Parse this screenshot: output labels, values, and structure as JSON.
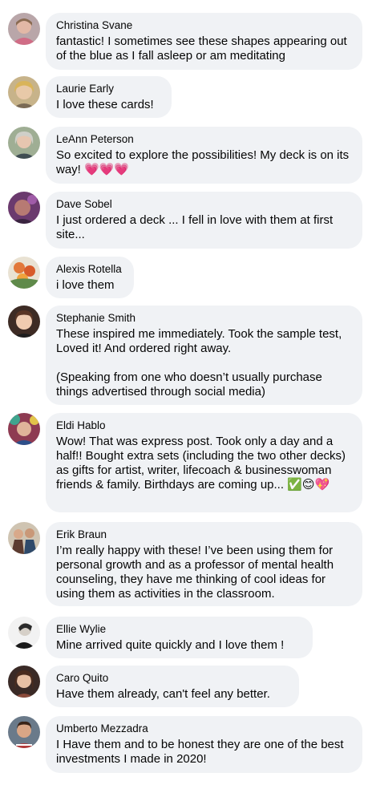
{
  "comments": [
    {
      "author": "Christina Svane",
      "text": "fantastic! I sometimes see these shapes appearing out of the blue as I fall asleep or am meditating",
      "avatar_icon": "profile-photo-icon"
    },
    {
      "author": "Laurie Early",
      "text": "I love these cards!",
      "avatar_icon": "profile-photo-icon"
    },
    {
      "author": "LeAnn Peterson",
      "text": "So excited to explore the possibilities! My deck is on its way! 💗💗💗",
      "avatar_icon": "profile-photo-icon"
    },
    {
      "author": "Dave Sobel",
      "text": "I just ordered a deck ... I fell in love with them at first site...",
      "avatar_icon": "profile-photo-icon"
    },
    {
      "author": "Alexis Rotella",
      "text": "i love them",
      "avatar_icon": "profile-photo-icon"
    },
    {
      "author": "Stephanie Smith",
      "text": "These inspired me immediately. Took the sample test, Loved it! And ordered right away.\n\n(Speaking from one who doesn’t usually purchase things advertised through social media)",
      "avatar_icon": "profile-photo-icon"
    },
    {
      "author": "Eldi Hablo",
      "text": "Wow! That was express post. Took only a day and a half!! Bought extra sets (including the two other decks) as gifts for artist, writer, lifecoach & businesswoman friends & family. Birthdays are coming up... ✅😊💖",
      "avatar_icon": "profile-photo-icon"
    },
    {
      "author": "Erik Braun",
      "text": "I’m really happy with these! I’ve been using them for personal growth and as a professor of mental health counseling, they have me thinking of cool ideas for using them as activities in the classroom.",
      "avatar_icon": "profile-photo-icon"
    },
    {
      "author": "Ellie Wylie",
      "text": "Mine arrived quite quickly and I love them !",
      "avatar_icon": "profile-photo-icon"
    },
    {
      "author": "Caro Quito",
      "text": "Have them already, can't feel any better.",
      "avatar_icon": "profile-photo-icon"
    },
    {
      "author": "Umberto Mezzadra",
      "text": "I Have them and to be honest they are one of the best investments I made in 2020!",
      "avatar_icon": "profile-photo-icon"
    }
  ],
  "colors": {
    "bubble": "#f0f2f5",
    "text": "#050505"
  }
}
